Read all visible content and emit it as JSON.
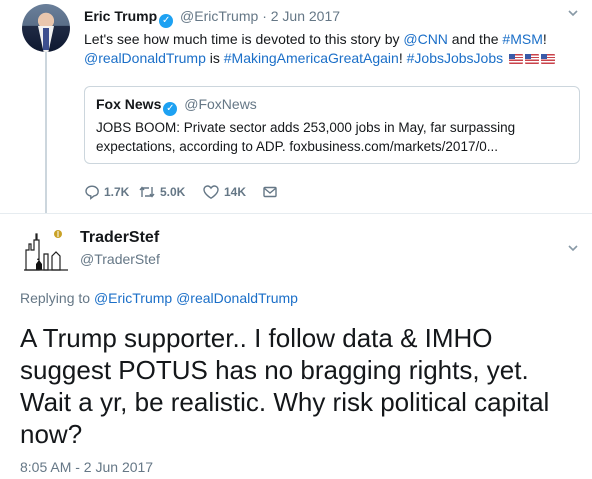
{
  "parent_tweet": {
    "name": "Eric Trump",
    "handle": "@EricTrump",
    "separator": "·",
    "date": "2 Jun 2017",
    "text_line1_pre": "Let's see how much time is devoted to this story by ",
    "text_line1_link1": "@CNN",
    "text_line1_mid": " and the ",
    "text_line1_link2": "#MSM",
    "text_line1_post": "!",
    "text_line2_link1": "@realDonaldTrump",
    "text_line2_mid": " is ",
    "text_line2_link2": "#MakingAmericaGreatAgain",
    "text_line2_mid2": "! ",
    "text_line2_link3": "#JobsJobsJobs",
    "quoted": {
      "name": "Fox News",
      "handle": "@FoxNews",
      "text": "JOBS BOOM: Private sector adds 253,000 jobs in May, far surpassing expectations, according to ADP. foxbusiness.com/markets/2017/0..."
    },
    "actions": {
      "replies": "1.7K",
      "retweets": "5.0K",
      "likes": "14K"
    }
  },
  "reply_tweet": {
    "name": "TraderStef",
    "handle": "@TraderStef",
    "replying_prefix": "Replying to ",
    "replying_to_1": "@EricTrump",
    "replying_to_2": "@realDonaldTrump",
    "text": "A Trump supporter.. I follow data & IMHO suggest POTUS has no bragging rights, yet. Wait a yr, be realistic. Why risk political capital now?",
    "timestamp": "8:05 AM - 2 Jun 2017"
  },
  "icons": {
    "verified": "verified-badge-icon",
    "caret": "chevron-down-icon",
    "reply": "reply-icon",
    "retweet": "retweet-icon",
    "like": "heart-icon",
    "dm": "envelope-icon",
    "flag": "us-flag-emoji"
  },
  "colors": {
    "link": "#1b6fc8",
    "verified": "#1da1f2",
    "muted": "#657786",
    "text": "#14171a"
  }
}
